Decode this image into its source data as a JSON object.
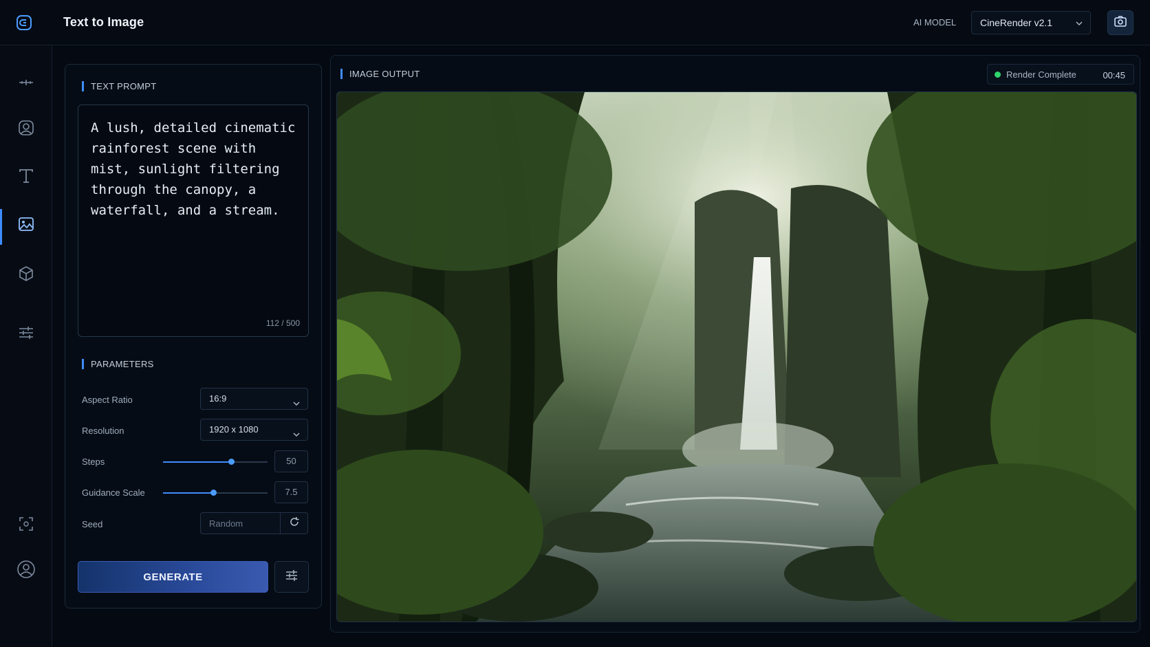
{
  "header": {
    "app_title": "Text to Image",
    "model_label": "AI MODEL",
    "model_value": "CineRender v2.1",
    "logo_icon": "app-logo-icon",
    "capture_icon": "camera-icon"
  },
  "sidebar": {
    "items": [
      {
        "icon": "move-icon",
        "active": false
      },
      {
        "icon": "face-icon",
        "active": false
      },
      {
        "icon": "text-icon",
        "active": false
      },
      {
        "icon": "image-icon",
        "active": true
      },
      {
        "icon": "cube-icon",
        "active": false
      },
      {
        "icon": "sliders-icon",
        "active": false
      },
      {
        "icon": "scan-icon",
        "active": false
      },
      {
        "icon": "user-icon",
        "active": false
      }
    ]
  },
  "prompt": {
    "section_title": "TEXT PROMPT",
    "text": "A lush, detailed cinematic rainforest scene with mist, sunlight filtering through the canopy, a waterfall, and a stream.",
    "char_count": "112 / 500"
  },
  "parameters": {
    "section_title": "PARAMETERS",
    "aspect_ratio": {
      "label": "Aspect Ratio",
      "value": "16:9"
    },
    "resolution": {
      "label": "Resolution",
      "value": "1920 x 1080"
    },
    "steps": {
      "label": "Steps",
      "value": "50",
      "fraction": 0.65
    },
    "guidance": {
      "label": "Guidance Scale",
      "value": "7.5",
      "fraction": 0.48
    },
    "seed": {
      "label": "Seed",
      "placeholder": "Random"
    }
  },
  "actions": {
    "generate_label": "GENERATE"
  },
  "output": {
    "section_title": "IMAGE OUTPUT",
    "status": "Render Complete",
    "time": "00:45",
    "accent": "#3f8cff",
    "status_color": "#2ed36b"
  }
}
